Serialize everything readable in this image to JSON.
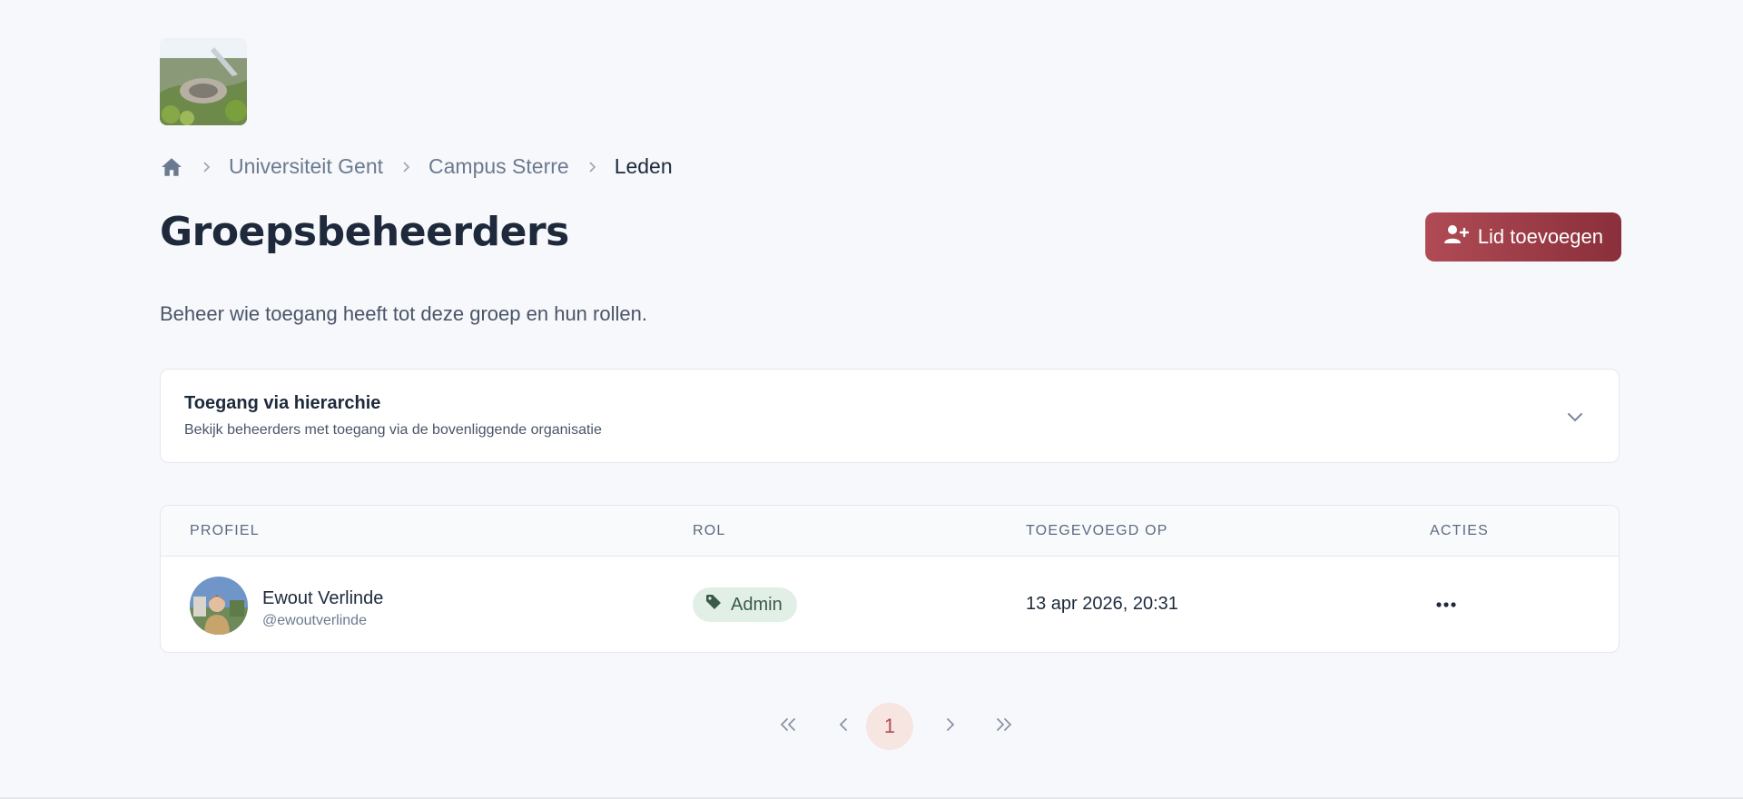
{
  "breadcrumb": {
    "items": [
      {
        "label": "Universiteit Gent"
      },
      {
        "label": "Campus Sterre"
      },
      {
        "label": "Leden"
      }
    ]
  },
  "page": {
    "title": "Groepsbeheerders",
    "subtitle": "Beheer wie toegang heeft tot deze groep en hun rollen."
  },
  "toolbar": {
    "add_label": "Lid toevoegen"
  },
  "hierarchy": {
    "title": "Toegang via hierarchie",
    "description": "Bekijk beheerders met toegang via de bovenliggende organisatie"
  },
  "table": {
    "columns": [
      "PROFIEL",
      "ROL",
      "TOEGEVOEGD OP",
      "ACTIES"
    ],
    "rows": [
      {
        "name": "Ewout Verlinde",
        "handle": "@ewoutverlinde",
        "role": "Admin",
        "added": "13 apr 2026, 20:31"
      }
    ]
  },
  "pagination": {
    "current": "1"
  },
  "colors": {
    "accent": "#b04b55",
    "accent_dark": "#8a2f3b",
    "role_badge_bg": "#e2efe7",
    "page_bg": "#f7f8fb"
  },
  "icons": {
    "home": "home-icon",
    "separator": "chevron-right-icon",
    "add": "user-plus-icon",
    "expand": "chevron-down-icon",
    "role": "tag-icon",
    "actions": "more-horizontal-icon",
    "first": "chevrons-left-icon",
    "prev": "chevron-left-icon",
    "next": "chevron-right-icon",
    "last": "chevrons-right-icon"
  }
}
